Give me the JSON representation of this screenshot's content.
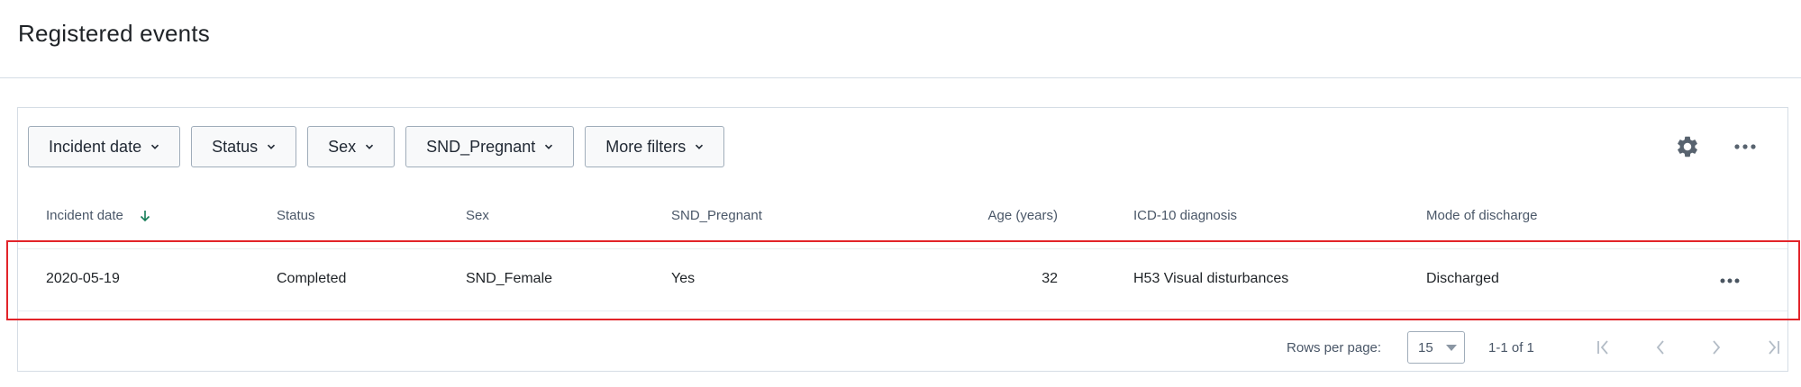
{
  "page": {
    "title": "Registered events"
  },
  "filters": [
    {
      "label": "Incident date"
    },
    {
      "label": "Status"
    },
    {
      "label": "Sex"
    },
    {
      "label": "SND_Pregnant"
    },
    {
      "label": "More filters"
    }
  ],
  "table": {
    "columns": [
      "Incident date",
      "Status",
      "Sex",
      "SND_Pregnant",
      "Age (years)",
      "ICD-10 diagnosis",
      "Mode of discharge"
    ],
    "sort_column": "Incident date",
    "rows": [
      {
        "cells": [
          "2020-05-19",
          "Completed",
          "SND_Female",
          "Yes",
          "32",
          "H53 Visual disturbances",
          "Discharged"
        ]
      }
    ]
  },
  "pagination": {
    "rows_per_page_label": "Rows per page:",
    "rows_per_page_value": "15",
    "range": "1-1 of 1"
  },
  "icons": {
    "settings": "gear-icon",
    "more": "more-horizontal-icon",
    "sort": "arrow-down-icon",
    "first": "first-page-icon",
    "prev": "chevron-left-icon",
    "next": "chevron-right-icon",
    "last": "last-page-icon"
  },
  "colors": {
    "highlight": "#e2242a",
    "sort_arrow": "#147c56",
    "border": "#d5dde5"
  }
}
